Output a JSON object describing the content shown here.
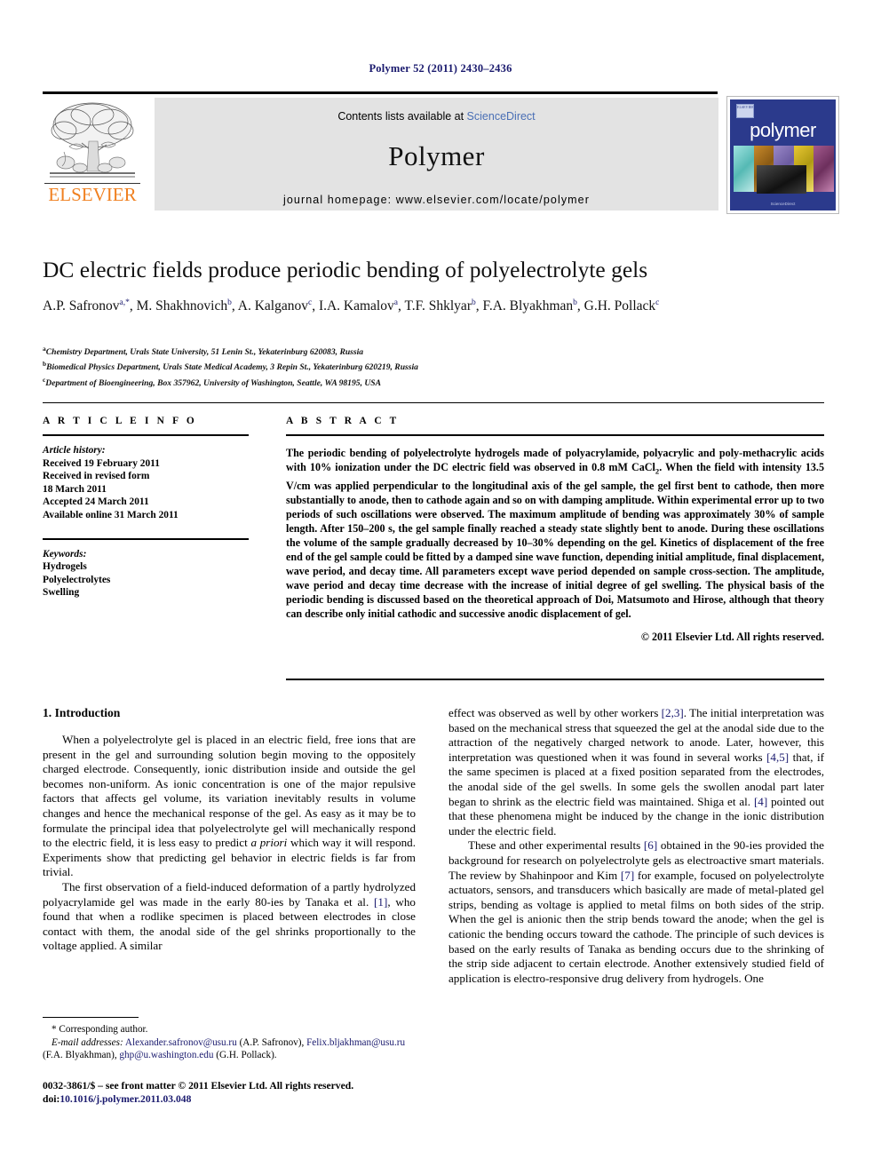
{
  "running_head": "Polymer 52 (2011) 2430–2436",
  "masthead": {
    "contents_prefix": "Contents lists available at ",
    "sciencedirect": "ScienceDirect",
    "journal_title": "Polymer",
    "homepage": "journal homepage: www.elsevier.com/locate/polymer",
    "publisher_name": "ELSEVIER",
    "cover_word": "polymer",
    "cover_mark": "ELSEVIER",
    "cover_bottom": "ScienceDirect",
    "accent_link_color": "#4a6fb5",
    "publisher_color": "#f08020",
    "cover_bg_color": "#2b3a8c"
  },
  "article": {
    "title": "DC electric fields produce periodic bending of polyelectrolyte gels",
    "authors_line1": "A.P. Safronov",
    "authors": [
      {
        "name": "A.P. Safronov",
        "sup": "a,*"
      },
      {
        "name": "M. Shakhnovich",
        "sup": "b"
      },
      {
        "name": "A. Kalganov",
        "sup": "c"
      },
      {
        "name": "I.A. Kamalov",
        "sup": "a"
      },
      {
        "name": "T.F. Shklyar",
        "sup": "b"
      },
      {
        "name": "F.A. Blyakhman",
        "sup": "b"
      },
      {
        "name": "G.H. Pollack",
        "sup": "c"
      }
    ],
    "affiliations": [
      {
        "marker": "a",
        "text": "Chemistry Department, Urals State University, 51 Lenin St., Yekaterinburg 620083, Russia"
      },
      {
        "marker": "b",
        "text": "Biomedical Physics Department, Urals State Medical Academy, 3 Repin St., Yekaterinburg 620219, Russia"
      },
      {
        "marker": "c",
        "text": "Department of Bioengineering, Box 357962, University of Washington, Seattle, WA 98195, USA"
      }
    ]
  },
  "article_info": {
    "heading": "A R T I C L E   I N F O",
    "history_label": "Article history:",
    "history": [
      "Received 19 February 2011",
      "Received in revised form",
      "18 March 2011",
      "Accepted 24 March 2011",
      "Available online 31 March 2011"
    ],
    "keywords_label": "Keywords:",
    "keywords": [
      "Hydrogels",
      "Polyelectrolytes",
      "Swelling"
    ]
  },
  "abstract": {
    "heading": "A B S T R A C T",
    "paragraph_1": "The periodic bending of polyelectrolyte hydrogels made of polyacrylamide, polyacrylic and poly-methacrylic acids with 10% ionization under the DC electric field was observed in 0.8 mM CaCl",
    "paragraph_1_sub": "2",
    "paragraph_2": ". When the field with intensity 13.5 V/cm was applied perpendicular to the longitudinal axis of the gel sample, the gel first bent to cathode, then more substantially to anode, then to cathode again and so on with damping amplitude. Within experimental error up to two periods of such oscillations were observed. The maximum amplitude of bending was approximately 30% of sample length. After 150–200 s, the gel sample finally reached a steady state slightly bent to anode. During these oscillations the volume of the sample gradually decreased by 10–30% depending on the gel. Kinetics of displacement of the free end of the gel sample could be fitted by a damped sine wave function, depending initial amplitude, final displacement, wave period, and decay time. All parameters except wave period depended on sample cross-section. The amplitude, wave period and decay time decrease with the increase of initial degree of gel swelling. The physical basis of the periodic bending is discussed based on the theoretical approach of Doi, Matsumoto and Hirose, although that theory can describe only initial cathodic and successive anodic displacement of gel.",
    "copyright": "© 2011 Elsevier Ltd. All rights reserved."
  },
  "body": {
    "section_1_heading": "1.  Introduction",
    "left_p1": "When a polyelectrolyte gel is placed in an electric field, free ions that are present in the gel and surrounding solution begin moving to the oppositely charged electrode. Consequently, ionic distribution inside and outside the gel becomes non-uniform. As ionic concentration is one of the major repulsive factors that affects gel volume, its variation inevitably results in volume changes and hence the mechanical response of the gel. As easy as it may be to formulate the principal idea that polyelectrolyte gel will mechanically respond to the electric field, it is less easy to predict ",
    "left_p1_italic": "a priori",
    "left_p1_tail": " which way it will respond. Experiments show that predicting gel behavior in electric fields is far from trivial.",
    "left_p2_a": "The first observation of a field-induced deformation of a partly hydrolyzed polyacrylamide gel was made in the early 80-ies by Tanaka et al. ",
    "left_p2_ref1": "[1]",
    "left_p2_b": ", who found that when a rodlike specimen is placed between electrodes in close contact with them, the anodal side of the gel shrinks proportionally to the voltage applied. A similar",
    "right_p1_a": "effect was observed as well by other workers ",
    "right_p1_ref1": "[2,3]",
    "right_p1_b": ". The initial interpretation was based on the mechanical stress that squeezed the gel at the anodal side due to the attraction of the negatively charged network to anode. Later, however, this interpretation was questioned when it was found in several works ",
    "right_p1_ref2": "[4,5]",
    "right_p1_c": " that, if the same specimen is placed at a fixed position separated from the electrodes, the anodal side of the gel swells. In some gels the swollen anodal part later began to shrink as the electric field was maintained. Shiga et al. ",
    "right_p1_ref3": "[4]",
    "right_p1_d": " pointed out that these phenomena might be induced by the change in the ionic distribution under the electric field.",
    "right_p2_a": "These and other experimental results ",
    "right_p2_ref1": "[6]",
    "right_p2_b": " obtained in the 90-ies provided the background for research on polyelectrolyte gels as electroactive smart materials. The review by Shahinpoor and Kim ",
    "right_p2_ref2": "[7]",
    "right_p2_c": " for example, focused on polyelectrolyte actuators, sensors, and transducers which basically are made of metal-plated gel strips, bending as voltage is applied to metal films on both sides of the strip. When the gel is anionic then the strip bends toward the anode; when the gel is cationic the bending occurs toward the cathode. The principle of such devices is based on the early results of Tanaka as bending occurs due to the shrinking of the strip side adjacent to certain electrode. Another extensively studied field of application is electro-responsive drug delivery from hydrogels. One"
  },
  "footnote": {
    "corresponding": "* Corresponding author.",
    "email_label": "E-mail addresses:",
    "email_1": "Alexander.safronov@usu.ru",
    "email_1_owner": " (A.P. Safronov), ",
    "email_2": "Felix.bljakhman@usu.ru",
    "email_2_owner": " (F.A. Blyakhman), ",
    "email_3": "ghp@u.washington.edu",
    "email_3_owner": " (G.H. Pollack)."
  },
  "footer": {
    "issn_line": "0032-3861/$ – see front matter © 2011 Elsevier Ltd. All rights reserved.",
    "doi_label": "doi:",
    "doi": "10.1016/j.polymer.2011.03.048"
  }
}
